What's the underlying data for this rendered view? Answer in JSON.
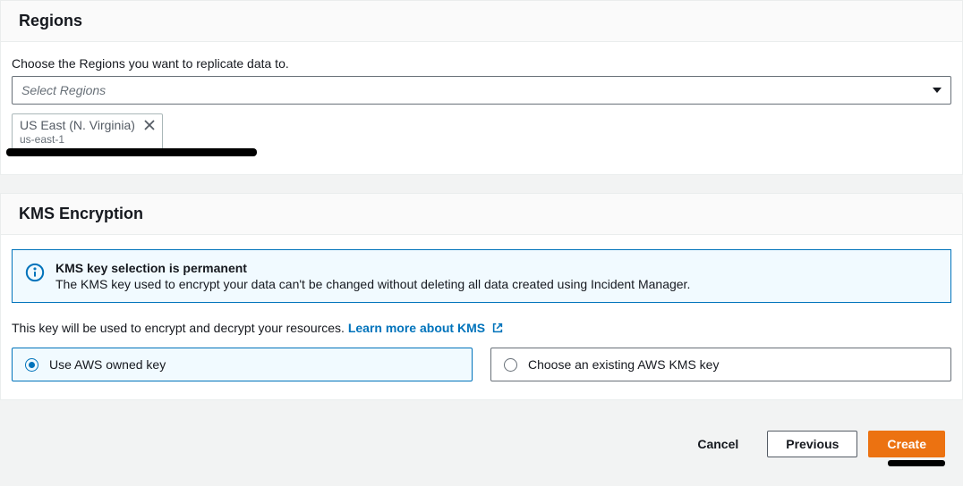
{
  "regions": {
    "title": "Regions",
    "label": "Choose the Regions you want to replicate data to.",
    "placeholder": "Select Regions",
    "selected": [
      {
        "name": "US East (N. Virginia)",
        "id": "us-east-1"
      }
    ]
  },
  "kms": {
    "title": "KMS Encryption",
    "notice": {
      "title": "KMS key selection is permanent",
      "description": "The KMS key used to encrypt your data can't be changed without deleting all data created using Incident Manager."
    },
    "help_text": "This key will be used to encrypt and decrypt your resources.",
    "learn_more": "Learn more about KMS",
    "options": {
      "owned": "Use AWS owned key",
      "existing": "Choose an existing AWS KMS key"
    }
  },
  "footer": {
    "cancel": "Cancel",
    "previous": "Previous",
    "create": "Create"
  }
}
